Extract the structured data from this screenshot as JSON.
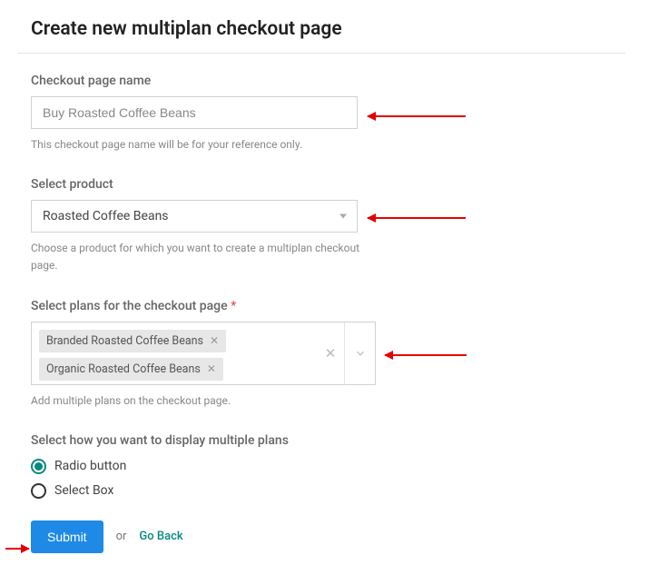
{
  "page_title": "Create new multiplan checkout page",
  "checkout_name": {
    "label": "Checkout page name",
    "value": "Buy Roasted Coffee Beans",
    "hint": "This checkout page name will be for your reference only."
  },
  "product": {
    "label": "Select product",
    "value": "Roasted Coffee Beans",
    "hint": "Choose a product for which you want to create a multiplan checkout page."
  },
  "plans": {
    "label": "Select plans for the checkout page",
    "required_mark": "*",
    "tags": [
      "Branded Roasted Coffee Beans",
      "Organic Roasted Coffee Beans"
    ],
    "hint": "Add multiple plans on the checkout page."
  },
  "display": {
    "label": "Select how you want to display multiple plans",
    "options": {
      "radio": "Radio button",
      "select_box": "Select Box"
    }
  },
  "actions": {
    "submit": "Submit",
    "or": "or",
    "go_back": "Go Back"
  }
}
